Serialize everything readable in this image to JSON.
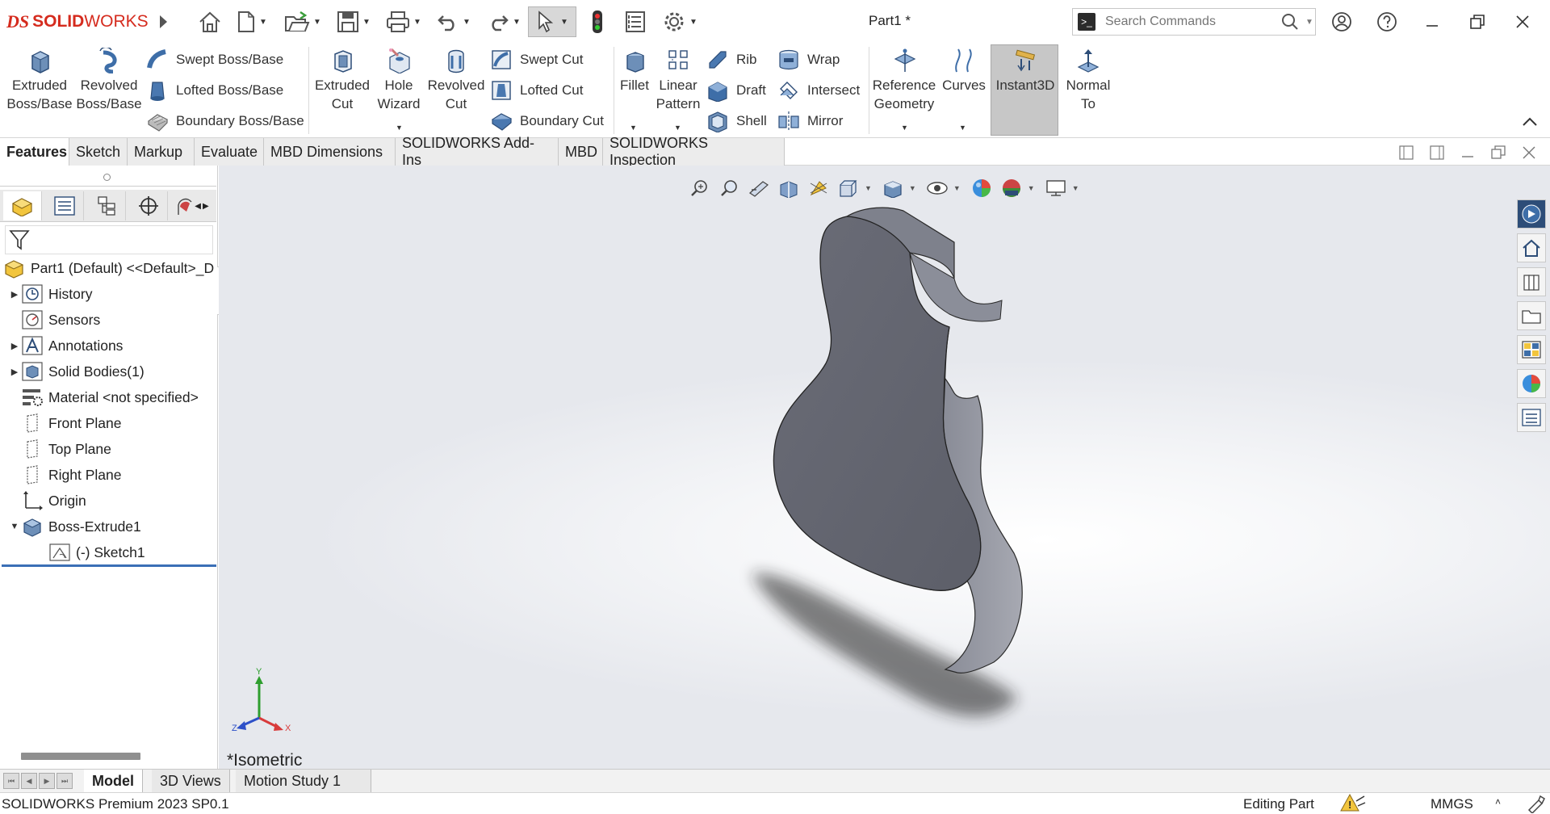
{
  "app": {
    "logo_prefix": "DS",
    "logo_solid": "SOLID",
    "logo_works": "WORKS",
    "document_title": "Part1 *"
  },
  "search": {
    "placeholder": "Search Commands"
  },
  "ribbon": {
    "extruded_boss": [
      "Extruded",
      "Boss/Base"
    ],
    "revolved_boss": [
      "Revolved",
      "Boss/Base"
    ],
    "swept_boss": "Swept Boss/Base",
    "lofted_boss": "Lofted Boss/Base",
    "boundary_boss": "Boundary Boss/Base",
    "extruded_cut": [
      "Extruded",
      "Cut"
    ],
    "hole_wizard": [
      "Hole",
      "Wizard"
    ],
    "revolved_cut": [
      "Revolved",
      "Cut"
    ],
    "swept_cut": "Swept Cut",
    "lofted_cut": "Lofted Cut",
    "boundary_cut": "Boundary Cut",
    "fillet": "Fillet",
    "linear_pattern": [
      "Linear",
      "Pattern"
    ],
    "rib": "Rib",
    "draft": "Draft",
    "shell": "Shell",
    "wrap": "Wrap",
    "intersect": "Intersect",
    "mirror": "Mirror",
    "reference_geometry": [
      "Reference",
      "Geometry"
    ],
    "curves": "Curves",
    "instant3d": "Instant3D",
    "normal_to": [
      "Normal",
      "To"
    ]
  },
  "command_tabs": [
    "Features",
    "Sketch",
    "Markup",
    "Evaluate",
    "MBD Dimensions",
    "SOLIDWORKS Add-Ins",
    "MBD",
    "SOLIDWORKS Inspection"
  ],
  "tree": {
    "root": "Part1 (Default) <<Default>_D",
    "items": [
      "History",
      "Sensors",
      "Annotations",
      "Solid Bodies(1)",
      "Material <not specified>",
      "Front Plane",
      "Top Plane",
      "Right Plane",
      "Origin",
      "Boss-Extrude1",
      "(-) Sketch1"
    ]
  },
  "viewport": {
    "view_name": "*Isometric",
    "triad": {
      "x": "X",
      "y": "Y",
      "z": "Z"
    },
    "model_color": "#565861"
  },
  "bottom_tabs": [
    "Model",
    "3D Views",
    "Motion Study 1"
  ],
  "status": {
    "product": "SOLIDWORKS Premium 2023 SP0.1",
    "mode": "Editing Part",
    "units": "MMGS",
    "units_caret": "˄"
  },
  "colors": {
    "brand_red": "#d52b1e",
    "selection_blue": "#3b6fb6"
  }
}
